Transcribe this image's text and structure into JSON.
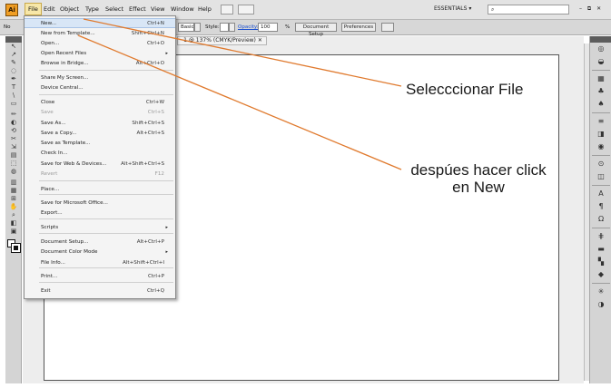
{
  "menubar": {
    "logo": "Ai",
    "menus": [
      "File",
      "Edit",
      "Object",
      "Type",
      "Select",
      "Effect",
      "View",
      "Window",
      "Help"
    ],
    "workspace": "ESSENTIALS",
    "workspace_arrow": "▾",
    "search_icon": "⌕",
    "window_controls": "– ⧉ ✕"
  },
  "controlbar": {
    "no_selection": "No",
    "stroke_value": "Basic",
    "style_label": "Style:",
    "opacity_label": "Opacity:",
    "opacity_value": "100",
    "opacity_unit": "%",
    "document_setup": "Document Setup",
    "preferences": "Preferences"
  },
  "document": {
    "tab_title": "-1 @ 137% (CMYK/Preview)",
    "tab_close": "✕"
  },
  "file_menu": {
    "items": [
      {
        "label": "New...",
        "shortcut": "Ctrl+N"
      },
      {
        "label": "New from Template...",
        "shortcut": "Shift+Ctrl+N"
      },
      {
        "label": "Open...",
        "shortcut": "Ctrl+O"
      },
      {
        "label": "Open Recent Files",
        "shortcut": "▸"
      },
      {
        "label": "Browse in Bridge...",
        "shortcut": "Alt+Ctrl+O"
      },
      {
        "label": "Share My Screen...",
        "shortcut": ""
      },
      {
        "label": "Device Central...",
        "shortcut": ""
      },
      {
        "label": "Close",
        "shortcut": "Ctrl+W"
      },
      {
        "label": "Save",
        "shortcut": "Ctrl+S"
      },
      {
        "label": "Save As...",
        "shortcut": "Shift+Ctrl+S"
      },
      {
        "label": "Save a Copy...",
        "shortcut": "Alt+Ctrl+S"
      },
      {
        "label": "Save as Template...",
        "shortcut": ""
      },
      {
        "label": "Check In...",
        "shortcut": ""
      },
      {
        "label": "Save for Web & Devices...",
        "shortcut": "Alt+Shift+Ctrl+S"
      },
      {
        "label": "Revert",
        "shortcut": "F12"
      },
      {
        "label": "Place...",
        "shortcut": ""
      },
      {
        "label": "Save for Microsoft Office...",
        "shortcut": ""
      },
      {
        "label": "Export...",
        "shortcut": ""
      },
      {
        "label": "Scripts",
        "shortcut": "▸"
      },
      {
        "label": "Document Setup...",
        "shortcut": "Alt+Ctrl+P"
      },
      {
        "label": "Document Color Mode",
        "shortcut": "▸"
      },
      {
        "label": "File Info...",
        "shortcut": "Alt+Shift+Ctrl+I"
      },
      {
        "label": "Print...",
        "shortcut": "Ctrl+P"
      },
      {
        "label": "Exit",
        "shortcut": "Ctrl+Q"
      }
    ]
  },
  "annotations": {
    "select_file": "Selecccionar File",
    "click_new_line1": "despúes hacer click",
    "click_new_line2": "en New",
    "line_color": "#e07a2e"
  },
  "icons": {
    "toolbox": [
      "↖",
      "↗",
      "✎",
      "◌",
      "✒",
      "T",
      "\\",
      "▭",
      "✏",
      "◐",
      "⟲",
      "✂",
      "⇲",
      "▤",
      "⬚",
      "◍",
      "▥",
      "▦",
      "⊞",
      "✋",
      "⌕",
      "◧",
      "▣"
    ],
    "dock": [
      "◎",
      "◒",
      "▦",
      "♣",
      "♠",
      "≡",
      "◨",
      "◉",
      "⊙",
      "◫",
      "A",
      "¶",
      "Ω",
      "⋕",
      "▬",
      "▚",
      "◆",
      "✳",
      "◑"
    ]
  }
}
